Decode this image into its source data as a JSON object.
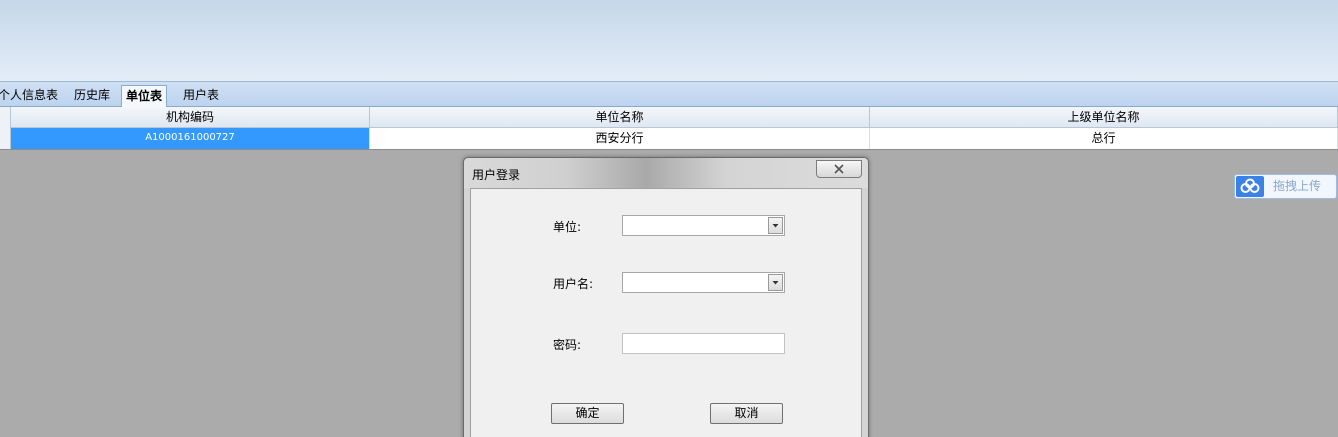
{
  "tabs": [
    {
      "label": "个人信息表",
      "active": false
    },
    {
      "label": "历史库",
      "active": false
    },
    {
      "label": "单位表",
      "active": true
    },
    {
      "label": "用户表",
      "active": false
    }
  ],
  "grid": {
    "columns": [
      "机构编码",
      "单位名称",
      "上级单位名称"
    ],
    "rows": [
      {
        "org_code": "A1000161000727",
        "unit_name": "西安分行",
        "parent_unit_name": "总行",
        "selected": true
      }
    ]
  },
  "upload_button": {
    "label": "拖拽上传",
    "icon": "cloud-upload-icon"
  },
  "login_dialog": {
    "title": "用户登录",
    "close_icon": "close-icon",
    "unit_label": "单位:",
    "unit_value": "",
    "username_label": "用户名:",
    "username_value": "",
    "password_label": "密码:",
    "password_value": "",
    "ok_label": "确定",
    "cancel_label": "取消"
  },
  "colors": {
    "selection": "#3399ff",
    "workspace": "#ababab",
    "banner": "#d6e3f1"
  }
}
